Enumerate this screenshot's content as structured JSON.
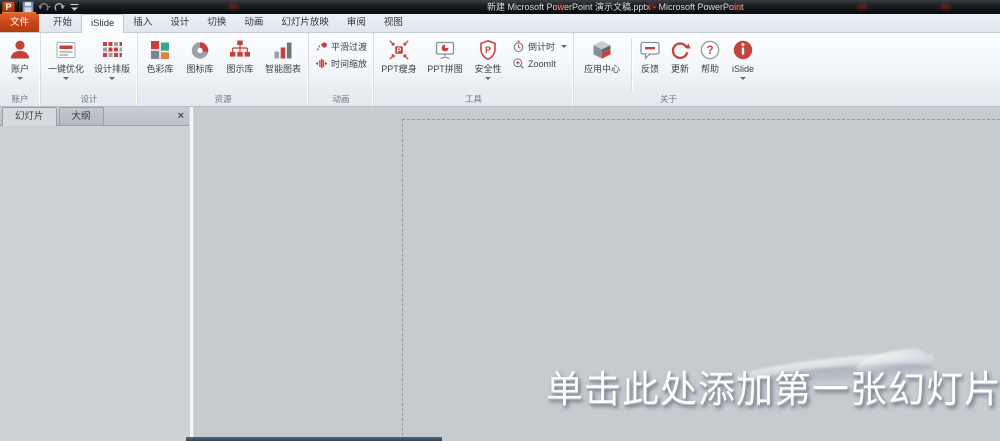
{
  "window": {
    "title": "新建 Microsoft PowerPoint 演示文稿.pptx - Microsoft PowerPoint"
  },
  "quick_access": {
    "app_glyph": "P"
  },
  "tab_row": {
    "active_tab": "iSlide",
    "tabs": [
      {
        "label": "文件"
      },
      {
        "label": "开始"
      },
      {
        "label": "iSlide"
      },
      {
        "label": "插入"
      },
      {
        "label": "设计"
      },
      {
        "label": "切换"
      },
      {
        "label": "动画"
      },
      {
        "label": "幻灯片放映"
      },
      {
        "label": "审阅"
      },
      {
        "label": "视图"
      }
    ]
  },
  "ribbon": {
    "groups": [
      {
        "label": "账户",
        "buttons": [
          {
            "label": "账户",
            "icon": "user-icon",
            "dropdown": true
          }
        ]
      },
      {
        "label": "设计",
        "buttons": [
          {
            "label": "一键优化",
            "icon": "one-key-optimize-icon",
            "dropdown": true
          },
          {
            "label": "设计排版",
            "icon": "design-layout-icon",
            "dropdown": true
          }
        ]
      },
      {
        "label": "资源",
        "buttons": [
          {
            "label": "色彩库",
            "icon": "color-library-icon"
          },
          {
            "label": "图标库",
            "icon": "icon-library-icon"
          },
          {
            "label": "图示库",
            "icon": "diagram-library-icon"
          },
          {
            "label": "智能图表",
            "icon": "smart-chart-icon"
          }
        ]
      },
      {
        "label": "动画",
        "buttons": [
          {
            "label": "平滑过渡",
            "icon": "smooth-transition-icon"
          },
          {
            "label": "时间缩放",
            "icon": "time-zoom-icon"
          }
        ]
      },
      {
        "label": "工具",
        "buttons": [
          {
            "label": "PPT瘦身",
            "icon": "ppt-slim-icon"
          },
          {
            "label": "PPT拼图",
            "icon": "ppt-puzzle-icon"
          },
          {
            "label": "安全性",
            "icon": "security-shield-icon",
            "dropdown": true
          },
          {
            "label": "倒计时",
            "icon": "countdown-clock-icon",
            "dropdown": true
          },
          {
            "label": "ZoomIt",
            "icon": "zoomit-icon"
          }
        ]
      },
      {
        "label": "关于",
        "buttons": [
          {
            "label": "应用中心",
            "icon": "app-center-cube-icon"
          },
          {
            "label": "反馈",
            "icon": "feedback-bubble-icon"
          },
          {
            "label": "更新",
            "icon": "update-refresh-icon"
          },
          {
            "label": "帮助",
            "icon": "help-question-icon"
          },
          {
            "label": "iSlide",
            "icon": "islide-logo-icon",
            "dropdown": true
          }
        ]
      }
    ]
  },
  "left_panel": {
    "tabs": [
      {
        "label": "幻灯片"
      },
      {
        "label": "大纲"
      }
    ],
    "close_glyph": "×"
  },
  "slide_area": {
    "placeholder_text": "单击此处添加第一张幻灯片"
  },
  "colors": {
    "accent_red": "#c5423c",
    "file_tab_orange": "#c84717",
    "titlebar_dark": "#101216",
    "workspace_gray": "#c7cbd0"
  }
}
